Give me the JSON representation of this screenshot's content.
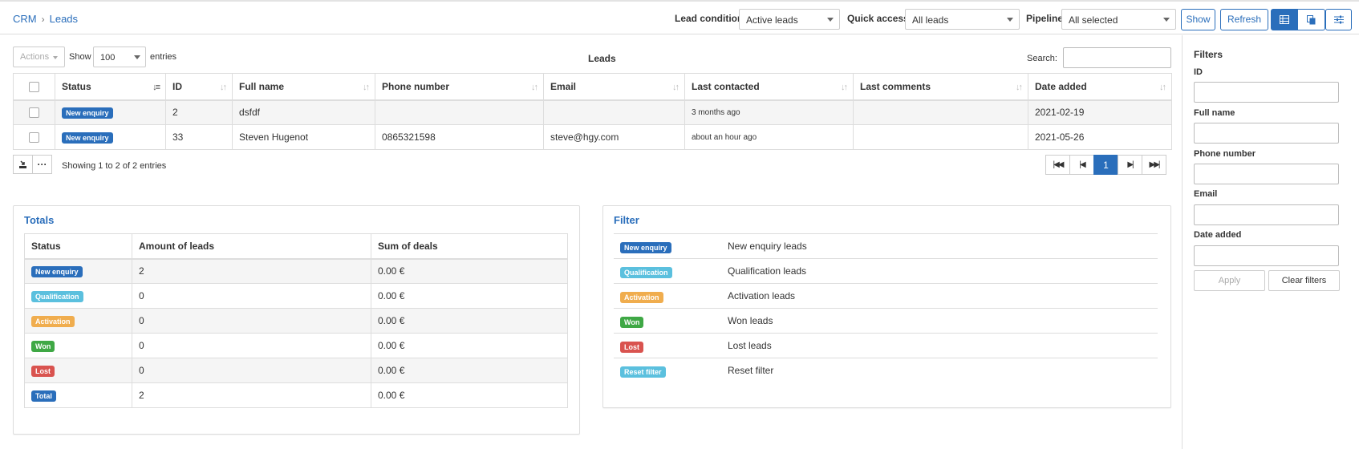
{
  "breadcrumb": {
    "root": "CRM",
    "current": "Leads"
  },
  "toolbar": {
    "lead_condition_label": "Lead condition",
    "lead_condition_value": "Active leads",
    "quick_access_label": "Quick access",
    "quick_access_value": "All leads",
    "pipeline_label": "Pipeline",
    "pipeline_value": "All selected",
    "show_label": "Show",
    "refresh_label": "Refresh"
  },
  "controls": {
    "actions_label": "Actions",
    "show_label": "Show",
    "entries_value": "100",
    "entries_label": "entries",
    "table_title": "Leads",
    "search_label": "Search:"
  },
  "leads_table": {
    "headers": [
      "Status",
      "ID",
      "Full name",
      "Phone number",
      "Email",
      "Last contacted",
      "Last comments",
      "Date added"
    ],
    "rows": [
      {
        "status": "New enquiry",
        "id": "2",
        "name": "dsfdf",
        "phone": "",
        "email": "",
        "last_contacted": "3 months ago",
        "last_comments": "",
        "date_added": "2021-02-19"
      },
      {
        "status": "New enquiry",
        "id": "33",
        "name": "Steven Hugenot",
        "phone": "0865321598",
        "email": "steve@hgy.com",
        "last_contacted": "about an hour ago",
        "last_comments": "",
        "date_added": "2021-05-26"
      }
    ],
    "info": "Showing 1 to 2 of 2 entries",
    "current_page": "1"
  },
  "totals": {
    "title": "Totals",
    "headers": [
      "Status",
      "Amount of leads",
      "Sum of deals"
    ],
    "rows": [
      {
        "status": "New enquiry",
        "amount": "2",
        "sum": "0.00 €"
      },
      {
        "status": "Qualification",
        "amount": "0",
        "sum": "0.00 €"
      },
      {
        "status": "Activation",
        "amount": "0",
        "sum": "0.00 €"
      },
      {
        "status": "Won",
        "amount": "0",
        "sum": "0.00 €"
      },
      {
        "status": "Lost",
        "amount": "0",
        "sum": "0.00 €"
      },
      {
        "status": "Total",
        "amount": "2",
        "sum": "0.00 €"
      }
    ]
  },
  "filter_panel": {
    "title": "Filter",
    "items": [
      {
        "badge": "New enquiry",
        "text": "New enquiry leads"
      },
      {
        "badge": "Qualification",
        "text": "Qualification leads"
      },
      {
        "badge": "Activation",
        "text": "Activation leads"
      },
      {
        "badge": "Won",
        "text": "Won leads"
      },
      {
        "badge": "Lost",
        "text": "Lost leads"
      },
      {
        "badge": "Reset filter",
        "text": "Reset filter"
      }
    ]
  },
  "sidebar": {
    "title": "Filters",
    "fields": [
      "ID",
      "Full name",
      "Phone number",
      "Email",
      "Date added"
    ],
    "apply_label": "Apply",
    "clear_label": "Clear filters"
  },
  "colors": {
    "primary": "#2a6ebb",
    "new_enquiry": "#2a6ebb",
    "qualification": "#5bc0de",
    "activation": "#f0ad4e",
    "won": "#3fa845",
    "lost": "#d9534f",
    "total": "#2a6ebb",
    "reset": "#5bc0de"
  },
  "icons": {
    "first_page": "first-page-icon",
    "prev_page": "prev-page-icon",
    "next_page": "next-page-icon",
    "last_page": "last-page-icon",
    "export": "export-icon",
    "more": "ellipsis-icon",
    "table_view": "table-view-icon",
    "copy_view": "copy-icon",
    "settings": "sliders-icon"
  }
}
